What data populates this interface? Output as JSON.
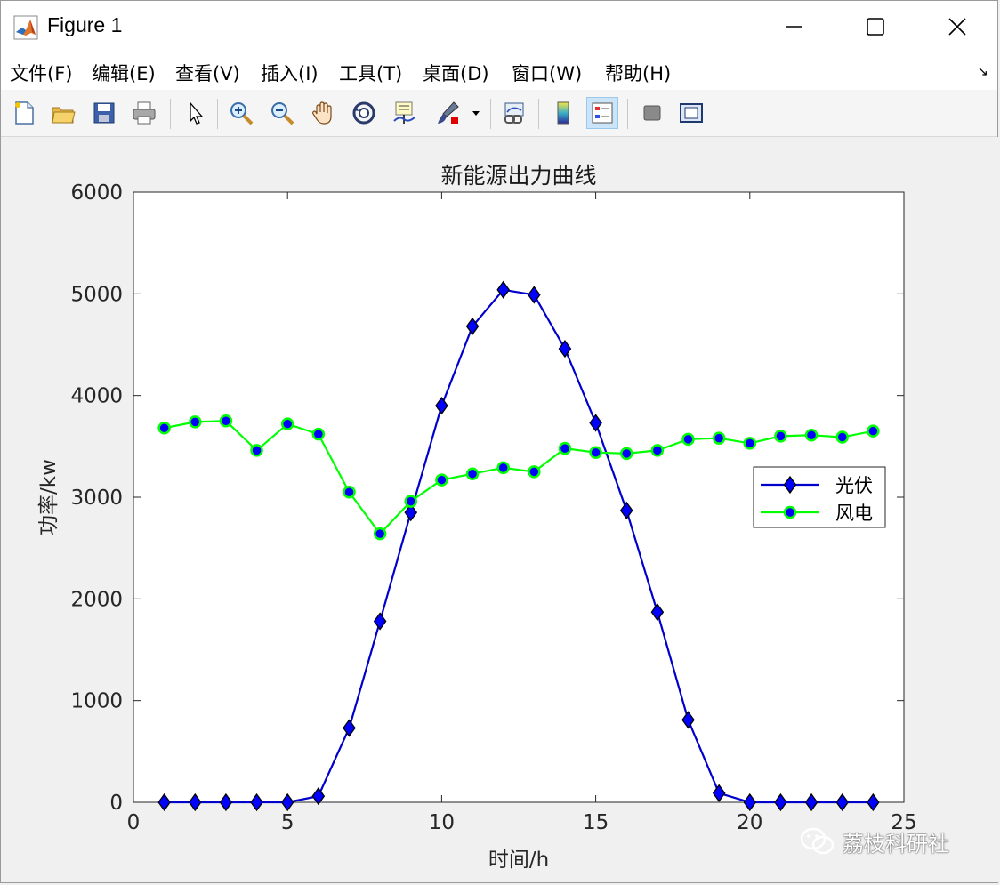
{
  "window": {
    "title": "Figure 1",
    "controls": {
      "minimize": "minimize",
      "maximize": "maximize",
      "close": "close"
    }
  },
  "menu": {
    "items": [
      "文件(F)",
      "编辑(E)",
      "查看(V)",
      "插入(I)",
      "工具(T)",
      "桌面(D)",
      "窗口(W)",
      "帮助(H)"
    ]
  },
  "toolbar": {
    "tools": [
      "new-figure-icon",
      "open-file-icon",
      "save-icon",
      "print-icon",
      "pointer-icon",
      "zoom-in-icon",
      "zoom-out-icon",
      "pan-icon",
      "rotate-3d-icon",
      "data-cursor-icon",
      "brush-icon",
      "link-plot-icon",
      "colorbar-icon",
      "legend-icon",
      "hide-plot-tools-icon",
      "show-plot-tools-icon"
    ]
  },
  "watermark": {
    "text": "荔枝科研社",
    "icon": "wechat-icon"
  },
  "colors": {
    "pv_line": "#0000cc",
    "pv_marker": "#0000ff",
    "wind_line": "#00ff00",
    "wind_marker": "#0000ff"
  },
  "chart_data": {
    "type": "line",
    "title": "新能源出力曲线",
    "xlabel": "时间/h",
    "ylabel": "功率/kw",
    "xlim": [
      0,
      25
    ],
    "ylim": [
      0,
      6000
    ],
    "xticks": [
      0,
      5,
      10,
      15,
      20,
      25
    ],
    "yticks": [
      0,
      1000,
      2000,
      3000,
      4000,
      5000,
      6000
    ],
    "grid": false,
    "legend_position": "right",
    "x": [
      1,
      2,
      3,
      4,
      5,
      6,
      7,
      8,
      9,
      10,
      11,
      12,
      13,
      14,
      15,
      16,
      17,
      18,
      19,
      20,
      21,
      22,
      23,
      24
    ],
    "series": [
      {
        "name": "光伏",
        "marker": "diamond",
        "color": "#0000cc",
        "values": [
          0,
          0,
          0,
          0,
          0,
          60,
          730,
          1780,
          2850,
          3900,
          4680,
          5040,
          4990,
          4460,
          3730,
          2870,
          1870,
          810,
          90,
          0,
          0,
          0,
          0,
          0
        ]
      },
      {
        "name": "风电",
        "marker": "circle",
        "color": "#00ff00",
        "values": [
          3680,
          3740,
          3750,
          3460,
          3720,
          3620,
          3050,
          2640,
          2960,
          3170,
          3230,
          3290,
          3250,
          3480,
          3440,
          3430,
          3460,
          3570,
          3580,
          3530,
          3600,
          3610,
          3590,
          3650
        ]
      }
    ]
  }
}
